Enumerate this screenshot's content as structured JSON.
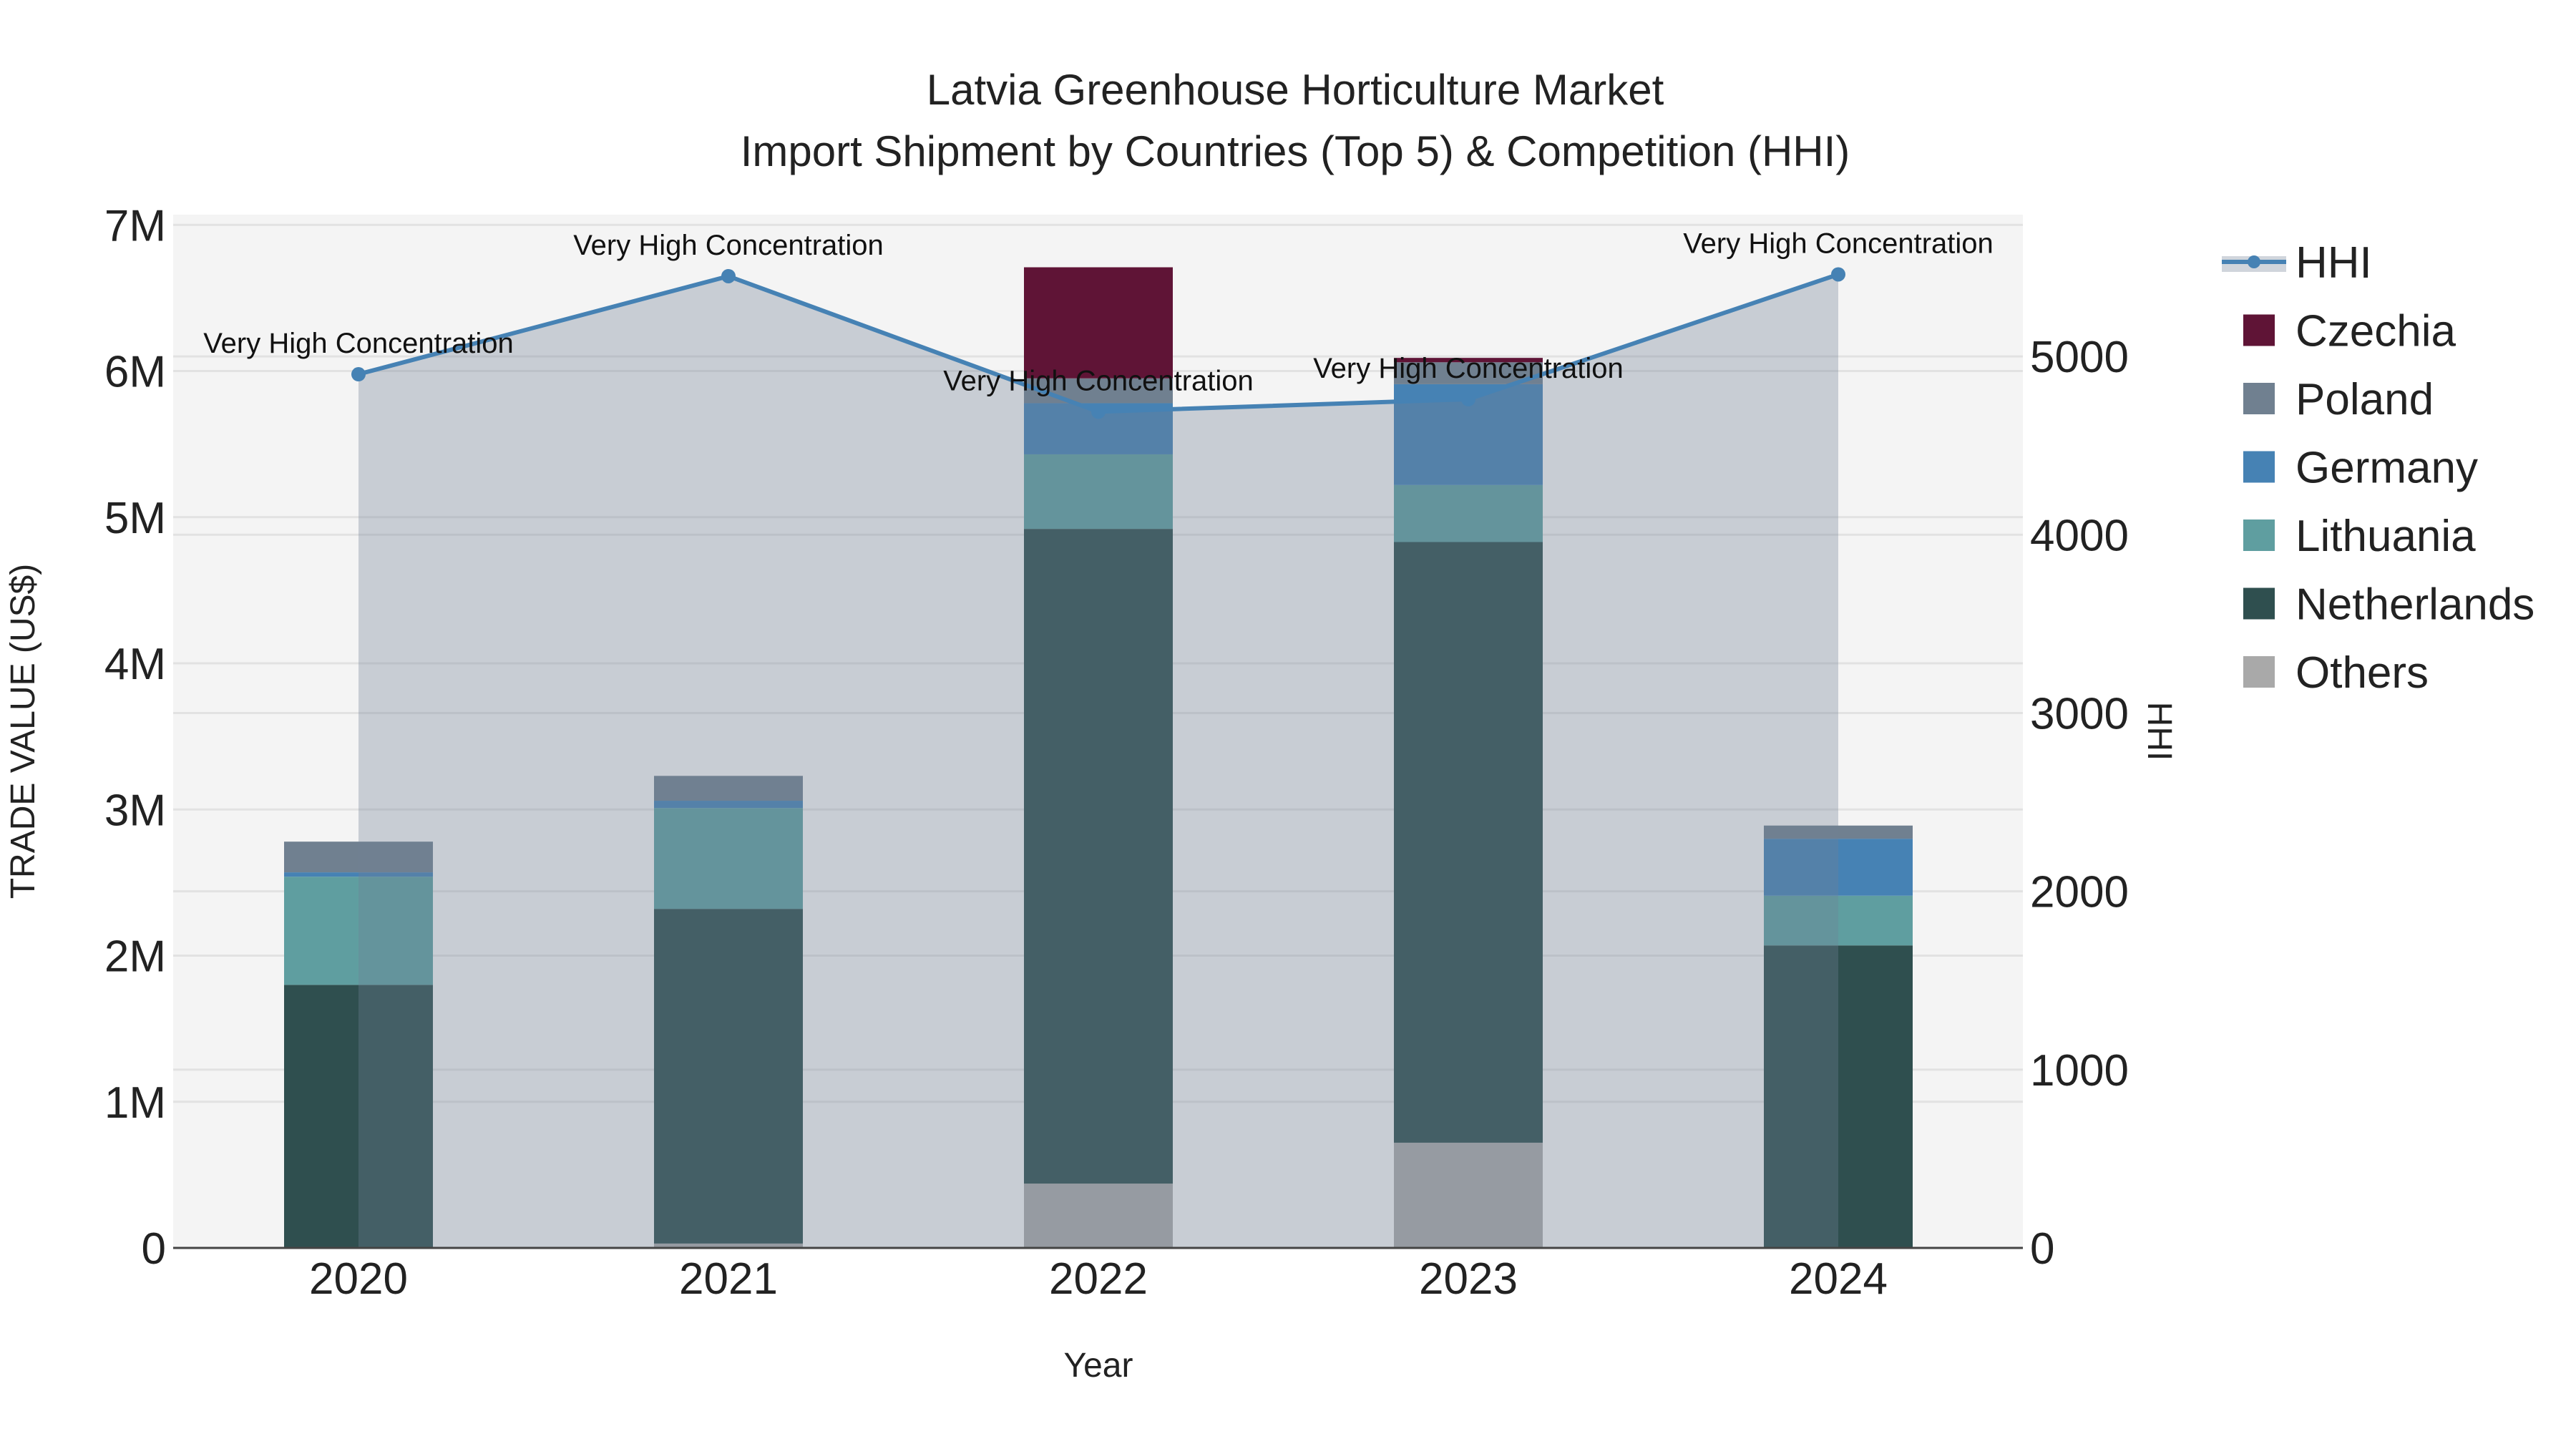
{
  "chart_data": {
    "type": "bar",
    "title_line1": "Latvia Greenhouse Horticulture Market",
    "title_line2": "Import Shipment by Countries (Top 5) & Competition (HHI)",
    "xlabel": "Year",
    "ylabel": "TRADE VALUE (US$)",
    "y2label": "HHI",
    "categories": [
      "2020",
      "2021",
      "2022",
      "2023",
      "2024"
    ],
    "ylim": [
      0,
      7070000
    ],
    "y2lim": [
      0,
      5795
    ],
    "yticks": [
      {
        "v": 0,
        "label": "0"
      },
      {
        "v": 1000000,
        "label": "1M"
      },
      {
        "v": 2000000,
        "label": "2M"
      },
      {
        "v": 3000000,
        "label": "3M"
      },
      {
        "v": 4000000,
        "label": "4M"
      },
      {
        "v": 5000000,
        "label": "5M"
      },
      {
        "v": 6000000,
        "label": "6M"
      },
      {
        "v": 7000000,
        "label": "7M"
      }
    ],
    "y2ticks": [
      {
        "v": 0,
        "label": "0"
      },
      {
        "v": 1000,
        "label": "1000"
      },
      {
        "v": 2000,
        "label": "2000"
      },
      {
        "v": 3000,
        "label": "3000"
      },
      {
        "v": 4000,
        "label": "4000"
      },
      {
        "v": 5000,
        "label": "5000"
      }
    ],
    "stack_order": [
      "Others",
      "Netherlands",
      "Lithuania",
      "Germany",
      "Poland",
      "Czechia"
    ],
    "series": [
      {
        "name": "Czechia",
        "color": "#5f1436",
        "values": [
          0,
          0,
          760000,
          30000,
          0
        ]
      },
      {
        "name": "Poland",
        "color": "#708090",
        "values": [
          210000,
          170000,
          170000,
          150000,
          90000
        ]
      },
      {
        "name": "Germany",
        "color": "#4682b4",
        "values": [
          30000,
          50000,
          350000,
          690000,
          390000
        ]
      },
      {
        "name": "Lithuania",
        "color": "#5f9ea0",
        "values": [
          740000,
          690000,
          510000,
          390000,
          340000
        ]
      },
      {
        "name": "Netherlands",
        "color": "#2f4f4f",
        "values": [
          1800000,
          2290000,
          4480000,
          4110000,
          2070000
        ]
      },
      {
        "name": "Others",
        "color": "#a9a9a9",
        "values": [
          0,
          30000,
          440000,
          720000,
          0
        ]
      }
    ],
    "hhi": {
      "name": "HHI",
      "color": "#4682b4",
      "values": [
        4900,
        5450,
        4690,
        4760,
        5460
      ],
      "annotations": [
        "Very High Concentration",
        "Very High Concentration",
        "Very High Concentration",
        "Very High Concentration",
        "Very High Concentration"
      ]
    },
    "legend_placement": "right",
    "grid": true
  }
}
